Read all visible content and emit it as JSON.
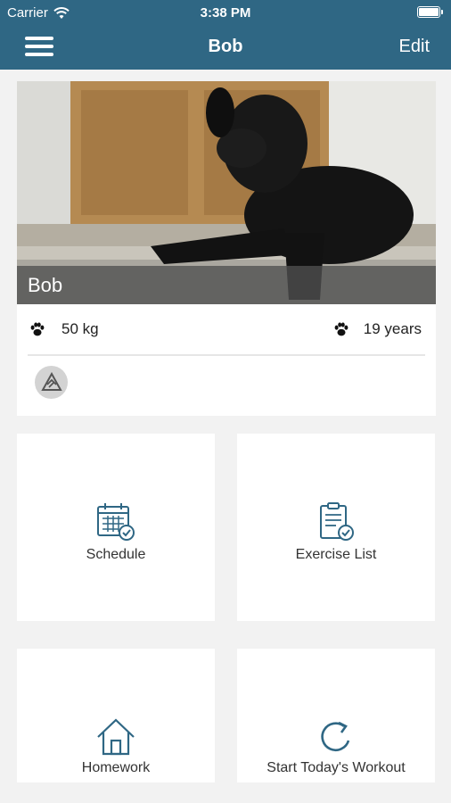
{
  "status_bar": {
    "carrier": "Carrier",
    "time": "3:38 PM"
  },
  "nav": {
    "title": "Bob",
    "edit_label": "Edit"
  },
  "profile": {
    "name": "Bob",
    "weight": "50 kg",
    "age": "19 years"
  },
  "tiles": {
    "schedule": "Schedule",
    "exercise_list": "Exercise List",
    "homework": "Homework",
    "workout": "Start Today's Workout"
  },
  "colors": {
    "header": "#2f6784",
    "icon": "#2f6784",
    "background": "#f2f2f2"
  },
  "icons": {
    "menu": "hamburger-icon",
    "wifi": "wifi-icon",
    "battery": "battery-icon",
    "paw": "paw-icon",
    "badge": "trainer-badge-icon",
    "schedule": "calendar-check-icon",
    "exercise": "clipboard-check-icon",
    "homework": "house-icon",
    "workout": "refresh-icon"
  }
}
